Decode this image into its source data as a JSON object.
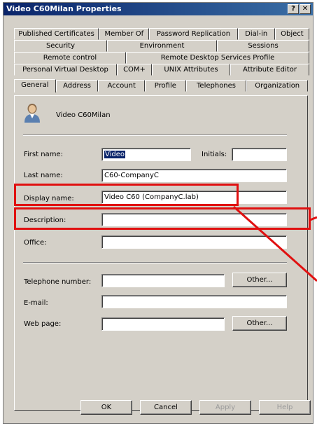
{
  "window": {
    "title": "Video C60Milan Properties",
    "help_label": "?",
    "close_label": "✕"
  },
  "tabs": {
    "row1": [
      "Published Certificates",
      "Member Of",
      "Password Replication",
      "Dial-in",
      "Object"
    ],
    "row2": [
      "Security",
      "Environment",
      "Sessions"
    ],
    "row3": [
      "Remote control",
      "Remote Desktop Services Profile"
    ],
    "row4": [
      "Personal Virtual Desktop",
      "COM+",
      "UNIX Attributes",
      "Attribute Editor"
    ],
    "row5": [
      "General",
      "Address",
      "Account",
      "Profile",
      "Telephones",
      "Organization"
    ],
    "active": "General"
  },
  "general": {
    "user_display": "Video C60Milan",
    "user_icon": "user-icon",
    "first_name_label": "First name:",
    "first_name_value": "Video",
    "initials_label": "Initials:",
    "initials_value": "",
    "last_name_label": "Last name:",
    "last_name_value": "C60-CompanyC",
    "display_name_label": "Display name:",
    "display_name_value": "Video C60 (CompanyC.lab)",
    "description_label": "Description:",
    "description_value": "",
    "office_label": "Office:",
    "office_value": "",
    "telephone_label": "Telephone number:",
    "telephone_value": "",
    "telephone_other": "Other...",
    "email_label": "E-mail:",
    "email_value": "",
    "webpage_label": "Web page:",
    "webpage_value": "",
    "webpage_other": "Other..."
  },
  "buttons": {
    "ok": "OK",
    "cancel": "Cancel",
    "apply": "Apply",
    "help": "Help"
  },
  "annotation": {
    "color": "#e01010"
  }
}
